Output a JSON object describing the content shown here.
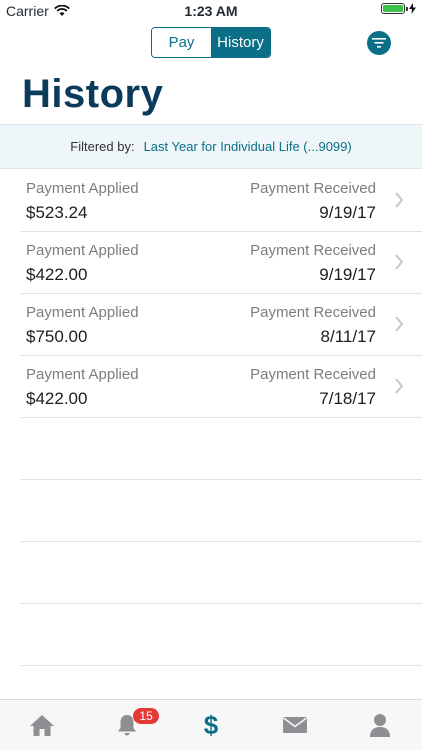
{
  "status_bar": {
    "carrier": "Carrier",
    "time": "1:23 AM"
  },
  "segments": {
    "pay_label": "Pay",
    "history_label": "History",
    "selected": "History"
  },
  "page": {
    "title": "History"
  },
  "filter": {
    "label": "Filtered by:",
    "value": "Last Year for Individual Life (...9099)"
  },
  "payments": [
    {
      "applied_label": "Payment Applied",
      "amount": "$523.24",
      "received_label": "Payment Received",
      "date": "9/19/17"
    },
    {
      "applied_label": "Payment Applied",
      "amount": "$422.00",
      "received_label": "Payment Received",
      "date": "9/19/17"
    },
    {
      "applied_label": "Payment Applied",
      "amount": "$750.00",
      "received_label": "Payment Received",
      "date": "8/11/17"
    },
    {
      "applied_label": "Payment Applied",
      "amount": "$422.00",
      "received_label": "Payment Received",
      "date": "7/18/17"
    }
  ],
  "tab_bar": {
    "items": [
      {
        "icon": "home-icon"
      },
      {
        "icon": "bell-icon",
        "badge": "15"
      },
      {
        "icon": "dollar-icon",
        "glyph": "$",
        "active": true
      },
      {
        "icon": "mail-icon"
      },
      {
        "icon": "profile-icon"
      }
    ]
  },
  "colors": {
    "accent": "#0b6f88",
    "title": "#0b3a5a",
    "badge": "#e53935",
    "battery": "#3cc14a"
  }
}
